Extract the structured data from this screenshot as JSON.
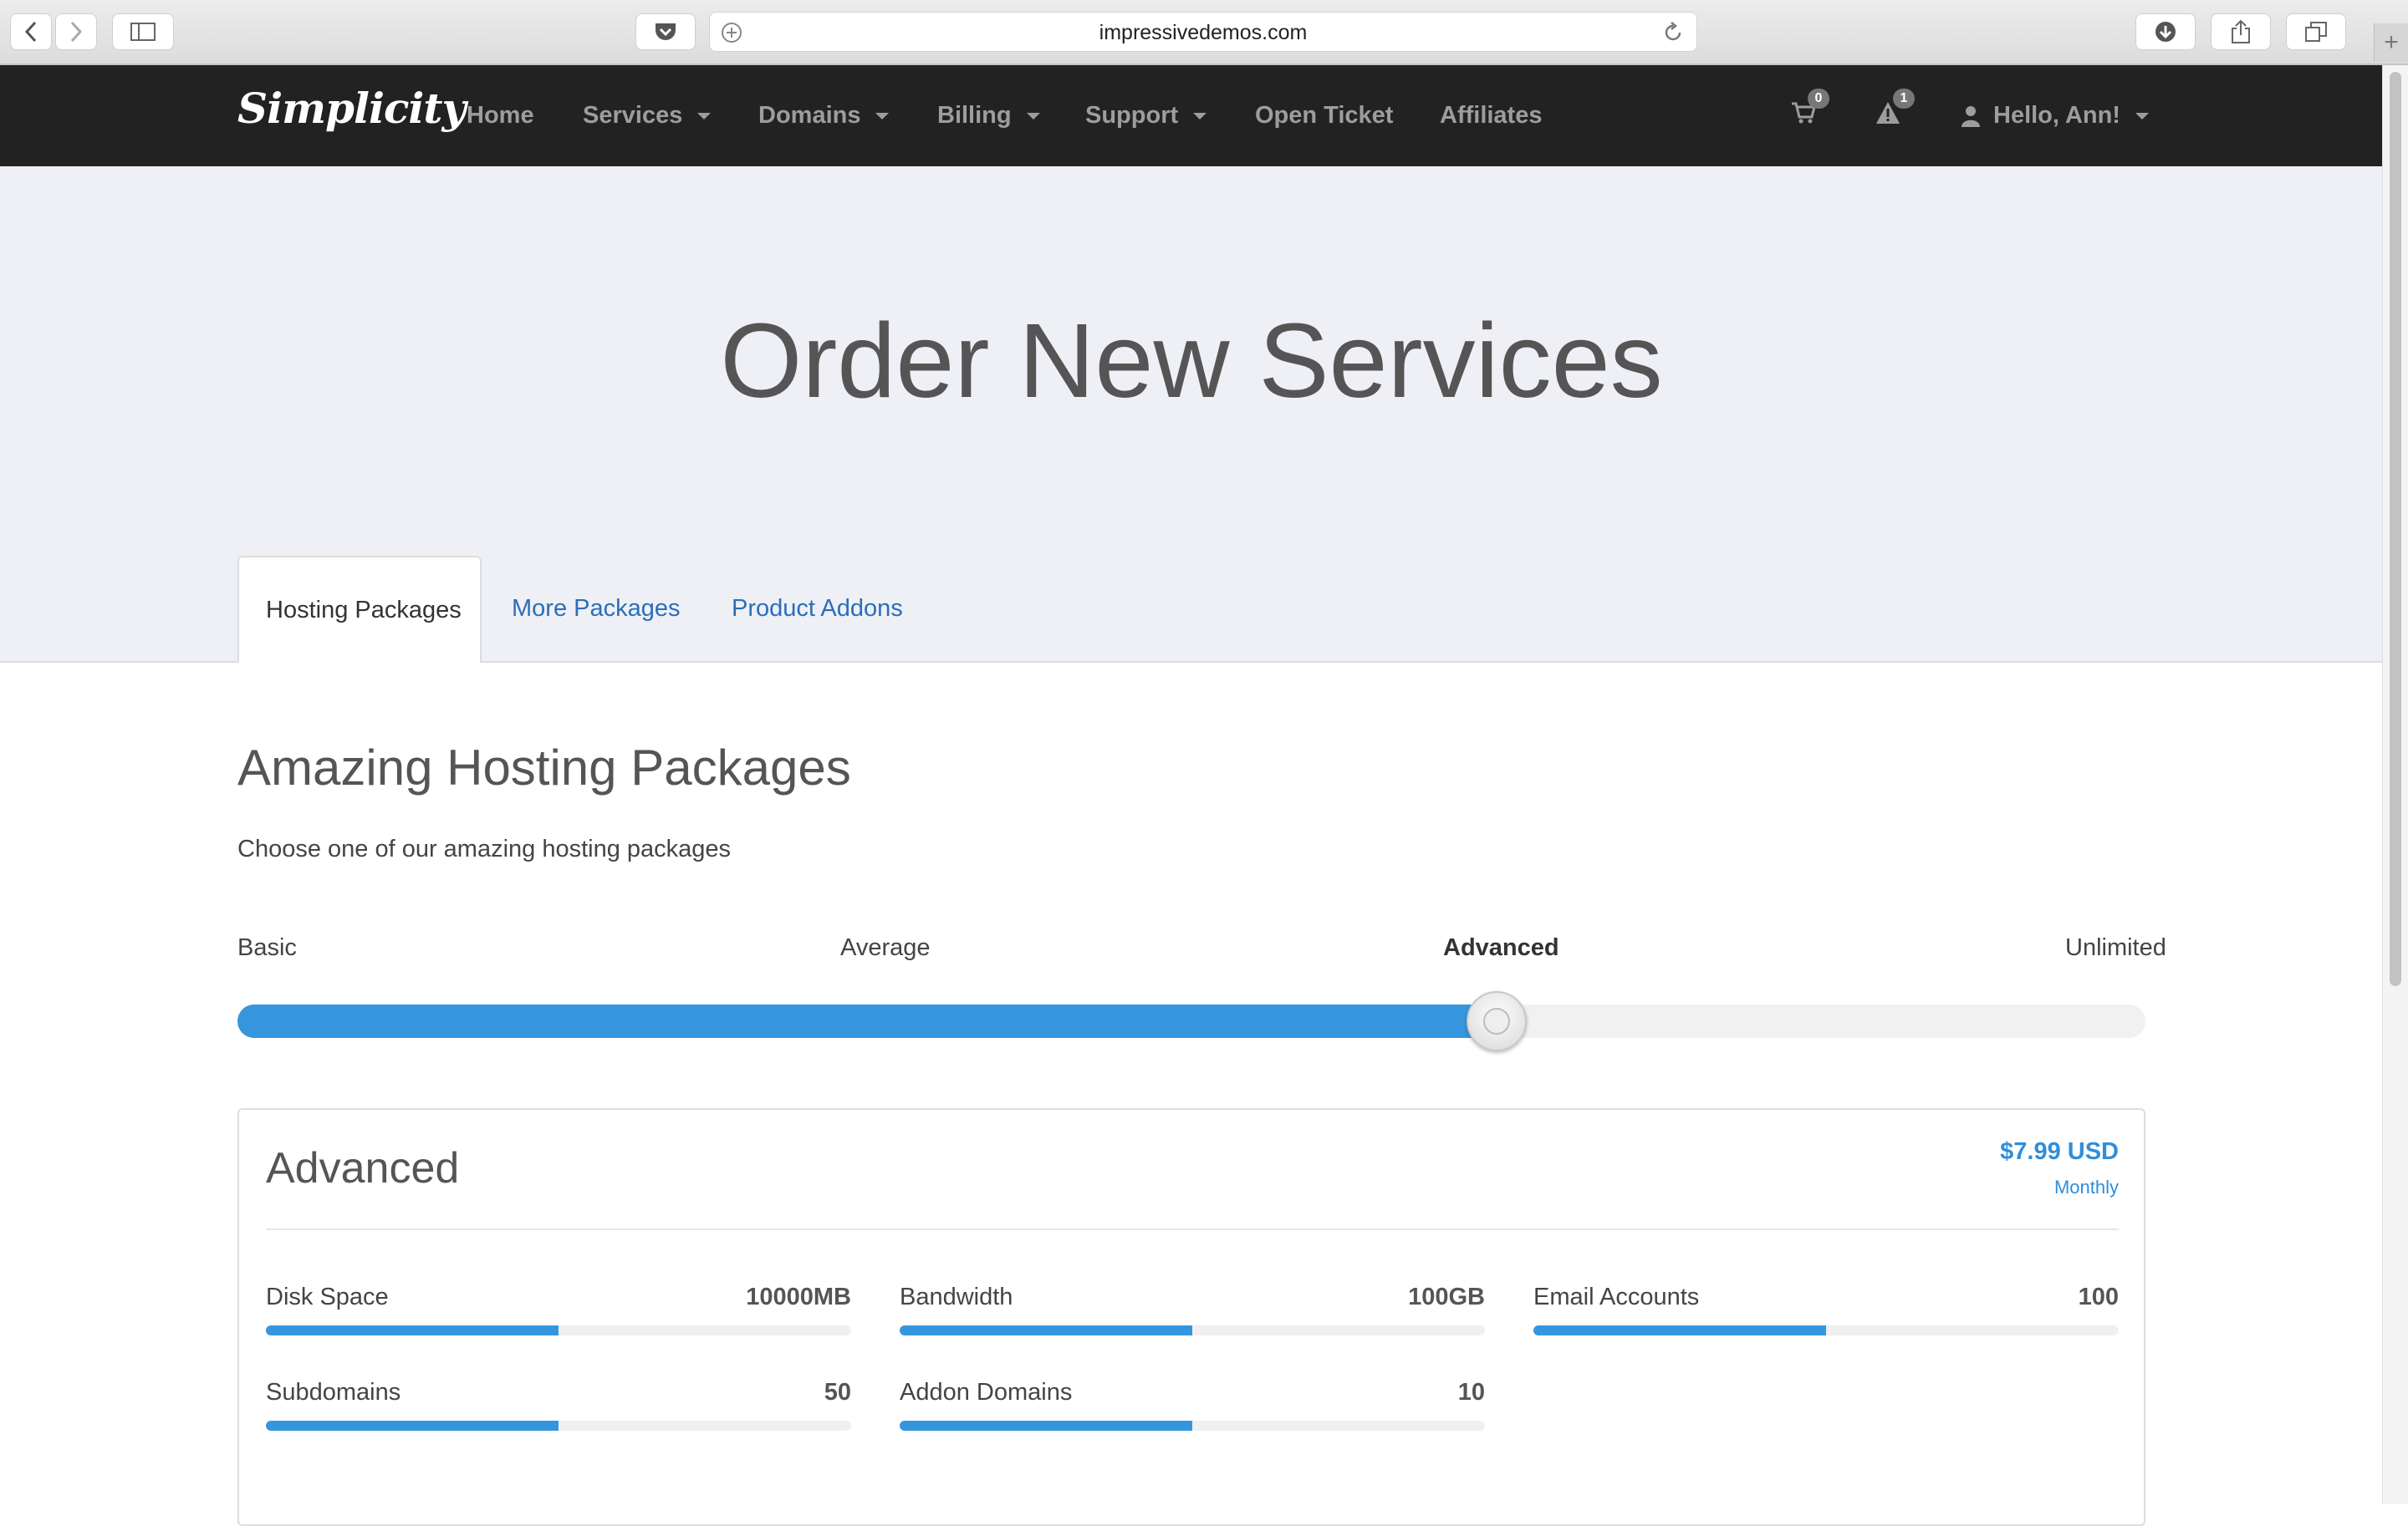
{
  "browser": {
    "url": "impressivedemos.com"
  },
  "navbar": {
    "brand": "Simplicity",
    "items": [
      {
        "label": "Home"
      },
      {
        "label": "Services"
      },
      {
        "label": "Domains"
      },
      {
        "label": "Billing"
      },
      {
        "label": "Support"
      },
      {
        "label": "Open Ticket"
      },
      {
        "label": "Affiliates"
      }
    ],
    "cart_count": "0",
    "alert_count": "1",
    "user_greeting": "Hello, Ann!"
  },
  "header": {
    "title": "Order New Services",
    "tabs": [
      {
        "label": "Hosting Packages",
        "active": true
      },
      {
        "label": "More Packages",
        "active": false
      },
      {
        "label": "Product Addons",
        "active": false
      }
    ]
  },
  "main": {
    "section_title": "Amazing Hosting Packages",
    "section_subtitle": "Choose one of our amazing hosting packages",
    "slider": {
      "levels": [
        "Basic",
        "Average",
        "Advanced",
        "Unlimited"
      ],
      "selected": "Advanced",
      "fill_fraction": 0.66
    },
    "package": {
      "name": "Advanced",
      "price": "$7.99 USD",
      "cycle": "Monthly",
      "features": [
        {
          "label": "Disk Space",
          "value": "10000MB",
          "fill": 0.5
        },
        {
          "label": "Bandwidth",
          "value": "100GB",
          "fill": 0.5
        },
        {
          "label": "Email Accounts",
          "value": "100",
          "fill": 0.5
        },
        {
          "label": "Subdomains",
          "value": "50",
          "fill": 0.5
        },
        {
          "label": "Addon Domains",
          "value": "10",
          "fill": 0.5
        }
      ]
    }
  },
  "colors": {
    "accent": "#3596de",
    "navbar_bg": "#222222",
    "header_bg": "#eff0f5"
  }
}
